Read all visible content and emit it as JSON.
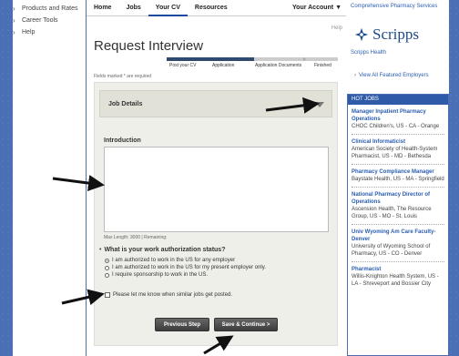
{
  "left_nav": {
    "items": [
      {
        "label": "Products and Rates"
      },
      {
        "label": "Career Tools"
      },
      {
        "label": "Help"
      }
    ]
  },
  "topnav": {
    "items": [
      "Home",
      "Jobs",
      "Your CV",
      "Resources"
    ],
    "active": "Your CV",
    "account": "Your Account ▼"
  },
  "page": {
    "help": "Help",
    "title": "Request Interview",
    "steps": [
      "Post your CV",
      "Application",
      "Application Documents",
      "Finished"
    ],
    "steps_completed": 2,
    "required_note": "Fields marked * are required"
  },
  "form": {
    "job_details_label": "Job Details",
    "intro_label": "Introduction",
    "intro_value": "",
    "max_length_note": "Max Length: 3000 | Remaining:",
    "auth_question": "What is your work authorization status?",
    "auth_options": [
      {
        "label": "I am authorized to work in the US for any employer",
        "selected": true
      },
      {
        "label": "I am authorized to work in the US for my present employer only.",
        "selected": false
      },
      {
        "label": "I require sponsorship to work in the US.",
        "selected": false
      }
    ],
    "similar_jobs_label": "Please let me know when similar jobs get posted.",
    "similar_jobs_checked": false,
    "prev_button": "Previous Step",
    "next_button": "Save & Continue >"
  },
  "sidebar": {
    "top_link": "Comprehensive Pharmacy Services",
    "logo_text": "Scripps",
    "scripps_link": "Scripps Health",
    "view_all": "View All Featured Employers",
    "hot_jobs_header": "HOT JOBS",
    "jobs": [
      {
        "title": "Manager Inpatient Pharmacy Operations",
        "sub": "CHOC Children's, US - CA - Orange"
      },
      {
        "title": "Clinical Informaticist",
        "sub": "American Society of Health-System Pharmacist, US - MD - Bethesda"
      },
      {
        "title": "Pharmacy Compliance Manager",
        "sub": "Baystate Health, US - MA - Springfield"
      },
      {
        "title": "National Pharmacy Director of Operations",
        "sub": "Ascension Health, The Resource Group, US - MO - St. Louis"
      },
      {
        "title": "Univ Wyoming Am Care Faculty-Denver",
        "sub": "University of Wyoming School of Pharmacy, US - CO - Denver"
      },
      {
        "title": "Pharmacist",
        "sub": "Willis-Knighton Health System, US - LA - Shreveport and Bossier City"
      }
    ]
  },
  "colors": {
    "page_bg": "#4a6fb5",
    "link": "#2a5db0",
    "progress_done": "#2e4a6e",
    "button": "#4a4a4a",
    "hot_jobs_header": "#2e5aa8"
  }
}
